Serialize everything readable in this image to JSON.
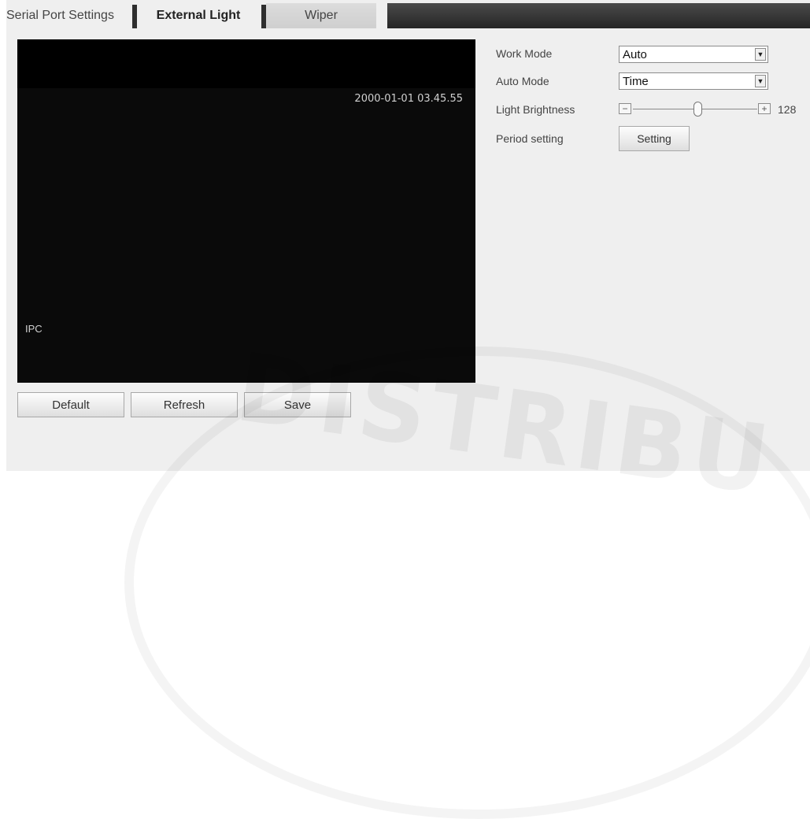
{
  "tabs": [
    {
      "label": "Serial Port Settings"
    },
    {
      "label": "External Light"
    },
    {
      "label": "Wiper"
    }
  ],
  "video": {
    "timestamp": "2000-01-01 03.45.55",
    "channel_label": "IPC"
  },
  "actions": {
    "default_label": "Default",
    "refresh_label": "Refresh",
    "save_label": "Save"
  },
  "settings": {
    "work_mode_label": "Work Mode",
    "work_mode_value": "Auto",
    "auto_mode_label": "Auto Mode",
    "auto_mode_value": "Time",
    "brightness_label": "Light Brightness",
    "brightness_value": "128",
    "brightness_max": 255,
    "brightness_minus": "−",
    "brightness_plus": "+",
    "period_label": "Period setting",
    "period_button_label": "Setting"
  },
  "watermark": {
    "text": "DISTRIBU"
  },
  "icons": {
    "dropdown": "chevron-down-icon"
  }
}
